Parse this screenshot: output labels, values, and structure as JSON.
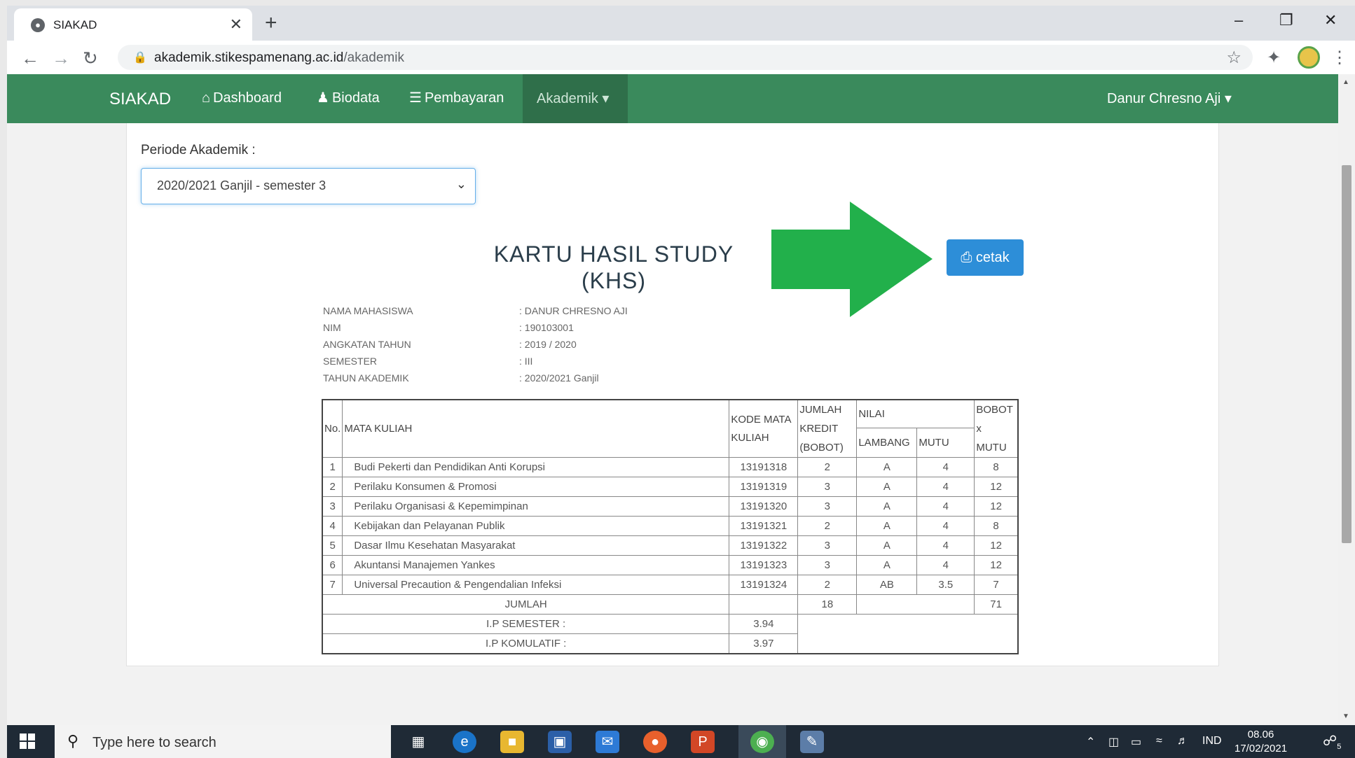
{
  "browser": {
    "tab_title": "SIAKAD",
    "url_host": "akademik.stikespamenang.ac.id",
    "url_path": "/akademik"
  },
  "navbar": {
    "brand": "SIAKAD",
    "items": [
      {
        "label": "Dashboard",
        "icon": "home-icon"
      },
      {
        "label": "Biodata",
        "icon": "user-icon"
      },
      {
        "label": "Pembayaran",
        "icon": "list-icon"
      }
    ],
    "active": {
      "label": "Akademik",
      "icon": "caret-down-icon"
    },
    "user": "Danur Chresno Aji"
  },
  "periode": {
    "label": "Periode Akademik :",
    "selected": "2020/2021 Ganjil - semester 3"
  },
  "khs": {
    "title_line1": "KARTU HASIL STUDY",
    "title_line2": "(KHS)",
    "print_label": "cetak",
    "info": [
      {
        "key": "NAMA MAHASISWA",
        "value": ": DANUR CHRESNO AJI"
      },
      {
        "key": "NIM",
        "value": ": 190103001"
      },
      {
        "key": "ANGKATAN TAHUN",
        "value": ": 2019 / 2020"
      },
      {
        "key": "SEMESTER",
        "value": ": III"
      },
      {
        "key": "TAHUN AKADEMIK",
        "value": ": 2020/2021 Ganjil"
      }
    ],
    "headers": {
      "no": "No.",
      "mata_kuliah": "MATA KULIAH",
      "kode": "KODE MATA KULIAH",
      "kredit_l1": "JUMLAH",
      "kredit_l2": "KREDIT",
      "kredit_l3": "(BOBOT)",
      "nilai": "NILAI",
      "lambang": "LAMBANG",
      "mutu": "MUTU",
      "bxm_l1": "BOBOT",
      "bxm_l2": "x",
      "bxm_l3": "MUTU"
    },
    "rows": [
      {
        "no": "1",
        "mk": "Budi Pekerti dan Pendidikan Anti Korupsi",
        "kode": "13191318",
        "kredit": "2",
        "lambang": "A",
        "mutu": "4",
        "bxm": "8"
      },
      {
        "no": "2",
        "mk": "Perilaku Konsumen & Promosi",
        "kode": "13191319",
        "kredit": "3",
        "lambang": "A",
        "mutu": "4",
        "bxm": "12"
      },
      {
        "no": "3",
        "mk": "Perilaku Organisasi & Kepemimpinan",
        "kode": "13191320",
        "kredit": "3",
        "lambang": "A",
        "mutu": "4",
        "bxm": "12"
      },
      {
        "no": "4",
        "mk": "Kebijakan dan Pelayanan Publik",
        "kode": "13191321",
        "kredit": "2",
        "lambang": "A",
        "mutu": "4",
        "bxm": "8"
      },
      {
        "no": "5",
        "mk": "Dasar Ilmu Kesehatan Masyarakat",
        "kode": "13191322",
        "kredit": "3",
        "lambang": "A",
        "mutu": "4",
        "bxm": "12"
      },
      {
        "no": "6",
        "mk": "Akuntansi Manajemen Yankes",
        "kode": "13191323",
        "kredit": "3",
        "lambang": "A",
        "mutu": "4",
        "bxm": "12"
      },
      {
        "no": "7",
        "mk": "Universal Precaution & Pengendalian Infeksi",
        "kode": "13191324",
        "kredit": "2",
        "lambang": "AB",
        "mutu": "3.5",
        "bxm": "7"
      }
    ],
    "jumlah_label": "JUMLAH",
    "jumlah_kredit": "18",
    "jumlah_bxm": "71",
    "ip_semester_label": "I.P SEMESTER :",
    "ip_semester": "3.94",
    "ip_kumulatif_label": "I.P KOMULATIF :",
    "ip_kumulatif": "3.97"
  },
  "taskbar": {
    "search_placeholder": "Type here to search",
    "lang": "IND",
    "time": "08.06",
    "date": "17/02/2021",
    "notif_count": "5"
  },
  "colors": {
    "navbar": "#3a8a5c",
    "nav_active": "#2f6f4a",
    "cetak_button": "#2d8ed8",
    "arrow": "#22b04b"
  }
}
